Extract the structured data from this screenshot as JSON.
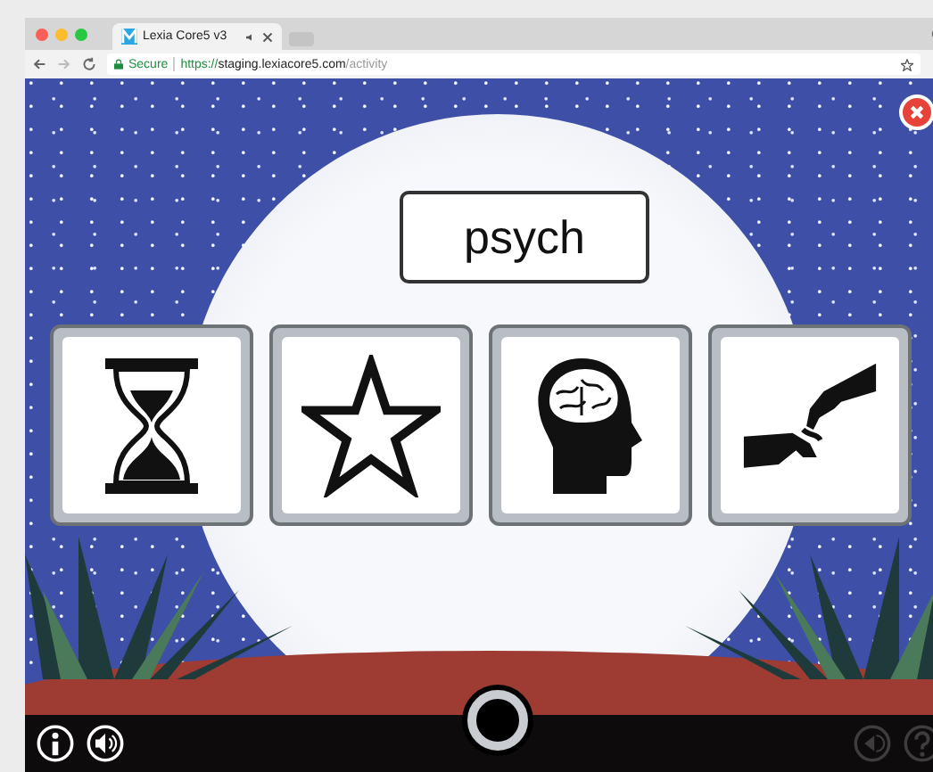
{
  "browser": {
    "tab_title": "Lexia Core5 v3",
    "url": {
      "secure_label": "Secure",
      "scheme": "https://",
      "host": "staging.lexiacore5.com",
      "path": "/activity"
    }
  },
  "activity": {
    "word": "psych",
    "choices": [
      {
        "kind": "hourglass"
      },
      {
        "kind": "star"
      },
      {
        "kind": "brain"
      },
      {
        "kind": "pinch"
      }
    ]
  },
  "controls": [
    {
      "kind": "info",
      "disabled": false
    },
    {
      "kind": "sound",
      "disabled": false
    },
    {
      "kind": "back",
      "disabled": true
    },
    {
      "kind": "help",
      "disabled": true
    }
  ]
}
